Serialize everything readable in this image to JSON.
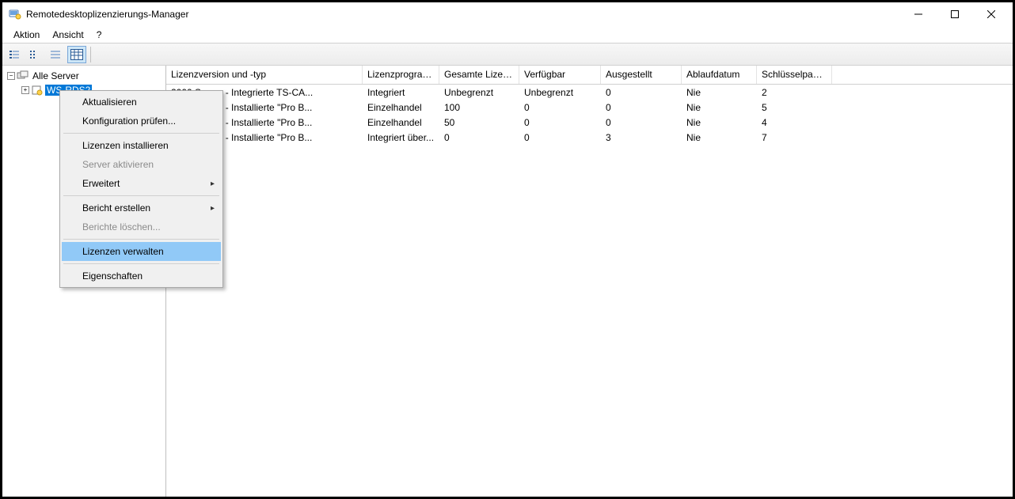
{
  "window": {
    "title": "Remotedesktoplizenzierungs-Manager"
  },
  "menubar": {
    "aktion": "Aktion",
    "ansicht": "Ansicht",
    "help": "?"
  },
  "tree": {
    "root": "Alle Server",
    "server": "WS-RDS2"
  },
  "columns": {
    "c0": "Lizenzversion und -typ",
    "c1": "Lizenzprogram...",
    "c2": "Gesamte Lizen...",
    "c3": "Verfügbar",
    "c4": "Ausgestellt",
    "c5": "Ablaufdatum",
    "c6": "Schlüsselpaket..."
  },
  "rows": [
    {
      "c0": "2000 Server - Integrierte TS-CA...",
      "c1": "Integriert",
      "c2": "Unbegrenzt",
      "c3": "Unbegrenzt",
      "c4": "0",
      "c5": "Nie",
      "c6": "2"
    },
    {
      "c0": "Server 2012 - Installierte \"Pro B...",
      "c1": "Einzelhandel",
      "c2": "100",
      "c3": "0",
      "c4": "0",
      "c5": "Nie",
      "c6": "5"
    },
    {
      "c0": "Server 2016 - Installierte \"Pro B...",
      "c1": "Einzelhandel",
      "c2": "50",
      "c3": "0",
      "c4": "0",
      "c5": "Nie",
      "c6": "4"
    },
    {
      "c0": "Server 2019 - Installierte \"Pro B...",
      "c1": "Integriert über...",
      "c2": "0",
      "c3": "0",
      "c4": "3",
      "c5": "Nie",
      "c6": "7"
    }
  ],
  "context_menu": {
    "refresh": "Aktualisieren",
    "check_config": "Konfiguration prüfen...",
    "install_licenses": "Lizenzen installieren",
    "activate_server": "Server aktivieren",
    "advanced": "Erweitert",
    "create_report": "Bericht erstellen",
    "delete_reports": "Berichte löschen...",
    "manage_licenses": "Lizenzen verwalten",
    "properties": "Eigenschaften"
  }
}
